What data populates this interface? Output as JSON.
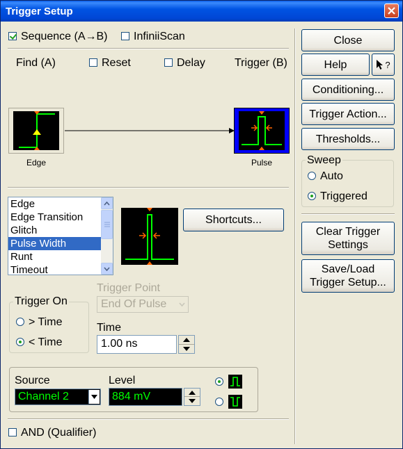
{
  "window": {
    "title": "Trigger Setup"
  },
  "top_options": {
    "sequence_label": "Sequence (A→B)",
    "infiniiscan_label": "InfiniiScan"
  },
  "sequence": {
    "find_label": "Find (A)",
    "reset_label": "Reset",
    "delay_label": "Delay",
    "trigger_label": "Trigger (B)",
    "edge_caption": "Edge",
    "pulse_caption": "Pulse"
  },
  "trigger_types": {
    "items": [
      "Edge",
      "Edge Transition",
      "Glitch",
      "Pulse Width",
      "Runt",
      "Timeout"
    ],
    "selected": "Pulse Width"
  },
  "shortcuts_label": "Shortcuts...",
  "trigger_point": {
    "label": "Trigger Point",
    "value": "End Of Pulse"
  },
  "trigger_on": {
    "label": "Trigger On",
    "options": [
      "> Time",
      "< Time"
    ],
    "selected": "< Time"
  },
  "time": {
    "label": "Time",
    "value": "1.00 ns"
  },
  "source": {
    "label": "Source",
    "value": "Channel 2"
  },
  "level": {
    "label": "Level",
    "value": "884 mV"
  },
  "and_qualifier_label": "AND (Qualifier)",
  "side": {
    "close_label": "Close",
    "help_label": "Help",
    "help_pointer_label": "?",
    "conditioning_label": "Conditioning...",
    "trigger_action_label": "Trigger Action...",
    "thresholds_label": "Thresholds...",
    "sweep": {
      "label": "Sweep",
      "options": [
        "Auto",
        "Triggered"
      ],
      "selected": "Triggered"
    },
    "clear_trigger_label": "Clear Trigger Settings",
    "save_load_label": "Save/Load Trigger Setup..."
  },
  "colors": {
    "trace": "#00ff00",
    "marker": "#ff6600",
    "pulse_bg": "#0000ff",
    "selection": "#316ac5"
  }
}
